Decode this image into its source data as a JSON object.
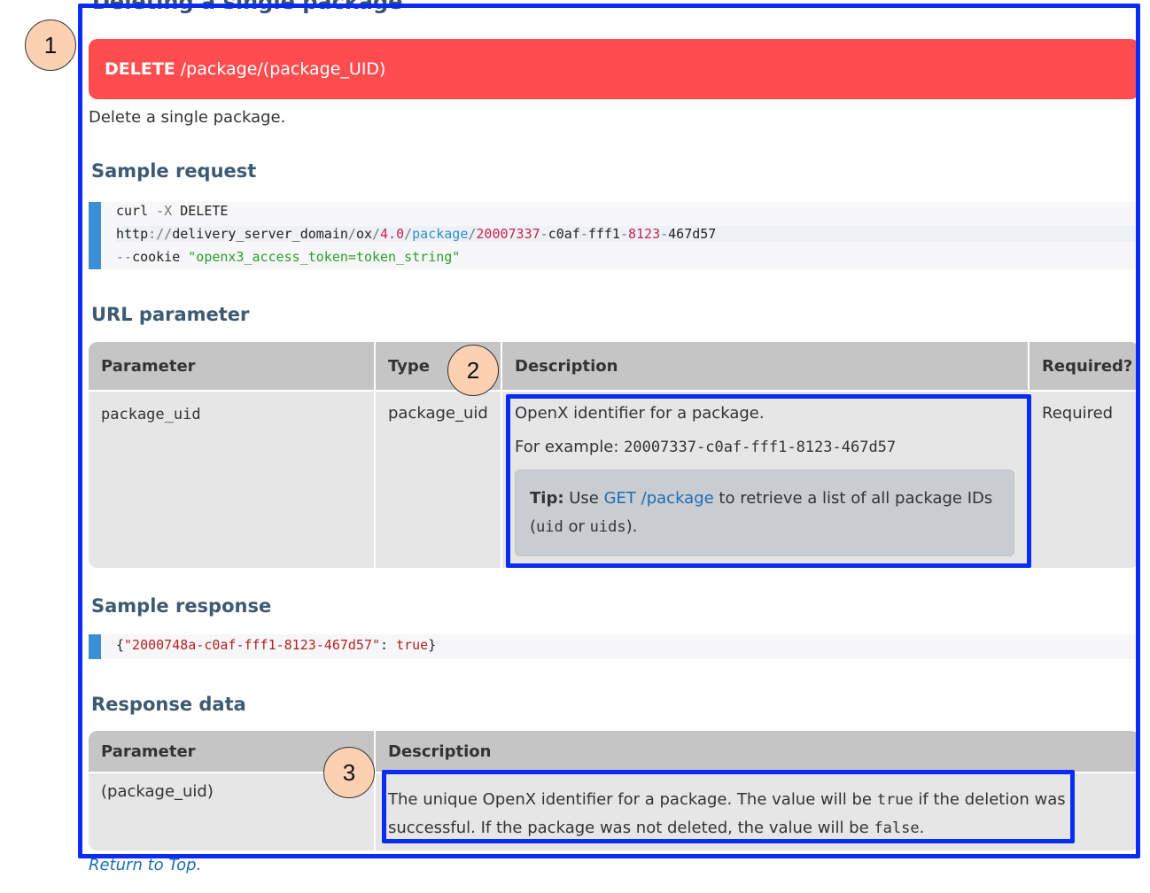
{
  "section_heading": "Deleting a single package",
  "endpoint": {
    "method": "DELETE",
    "path": "/package/(package_UID)",
    "color": "#ff4d4f"
  },
  "intro": "Delete a single package.",
  "sample_request": {
    "heading": "Sample request",
    "line1": {
      "cmd": "curl ",
      "flag": "-X",
      "rest": " DELETE"
    },
    "line2": {
      "scheme": "http",
      "sep1": "://",
      "host": "delivery_server_domain",
      "s1": "/",
      "ox": "ox",
      "s2": "/",
      "ver": "4.0",
      "s3": "/",
      "pkg": "package",
      "s4": "/",
      "id1": "20007337",
      "d1": "-",
      "id2": "c0af",
      "d2": "-",
      "id3": "fff1",
      "d3": "-",
      "id4": "8123",
      "d4": "-",
      "id5": "467d57"
    },
    "line3": {
      "flag": "--",
      "opt": "cookie",
      "val": "\"openx3_access_token=token_string\""
    }
  },
  "url_parameter": {
    "heading": "URL parameter",
    "headers": [
      "Parameter",
      "Type",
      "Description",
      "Required?"
    ],
    "row": {
      "parameter": "package_uid",
      "type": "package_uid",
      "desc1": "OpenX identifier for a package.",
      "desc2_label": "For example: ",
      "desc2_code": "20007337-c0af-fff1-8123-467d57",
      "tip_label": "Tip:",
      "tip_text1": " Use ",
      "tip_link": "GET /package",
      "tip_text2": " to retrieve a list of all package IDs",
      "tip_text3": "(",
      "tip_code1": "uid",
      "tip_text4": " or ",
      "tip_code2": "uids",
      "tip_text5": ").",
      "required": "Required"
    }
  },
  "sample_response": {
    "heading": "Sample response",
    "open": "{",
    "key": "\"2000748a-c0af-fff1-8123-467d57\"",
    "colon": ": ",
    "val": "true",
    "close": "}"
  },
  "response_data": {
    "heading": "Response data",
    "headers": [
      "Parameter",
      "Description"
    ],
    "row": {
      "parameter": "(package_uid)",
      "d1": "The unique OpenX identifier for a package. The value will be ",
      "code_true": "true",
      "d2": " if the deletion was",
      "d3": "successful. If the package was not deleted, the value will be ",
      "code_false": "false",
      "d4": "."
    }
  },
  "return_to_top": "Return to Top.",
  "callouts": [
    "1",
    "2",
    "3"
  ],
  "colors": {
    "annotation_blue": "#0a2cf5",
    "callout_fill": "#fcd0b2",
    "heading": "#3d5a73",
    "link": "#1c6db8"
  }
}
